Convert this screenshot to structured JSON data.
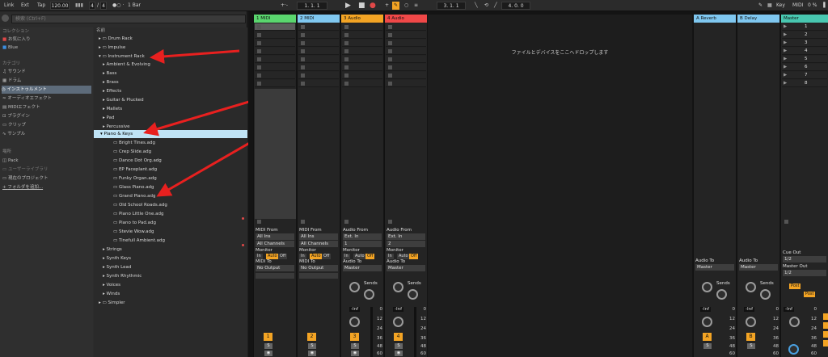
{
  "toolbar": {
    "link": "Link",
    "ext": "Ext",
    "tap": "Tap",
    "tempo": "120.00",
    "sig_num": "4",
    "sig_den": "4",
    "quant": "1 Bar",
    "pos1": "1. 1. 1",
    "pos2": "3. 1. 1",
    "pos3": "4. 0. 0",
    "key": "Key",
    "midi": "MIDI",
    "cpu": "0 %"
  },
  "browser": {
    "search_placeholder": "検索 (Ctrl+F)",
    "collections_header": "コレクション",
    "fav": "お気に入り",
    "blue": "Blue",
    "category_header": "カテゴリ",
    "categories": [
      "サウンド",
      "ドラム",
      "インストゥルメント",
      "オーディオエフェクト",
      "MIDIエフェクト",
      "プラグイン",
      "クリップ",
      "サンプル"
    ],
    "places_header": "場所",
    "places": [
      "Pack",
      "ユーザーライブラリ",
      "現在のプロジェクト",
      "フォルダを追加..."
    ],
    "files_header": "名前",
    "files": [
      "Drum Rack",
      "Impulse",
      "Instrument Rack",
      "Ambient & Evolving",
      "Bass",
      "Brass",
      "Effects",
      "Guitar & Plucked",
      "Mallets",
      "Pad",
      "Percussive",
      "Piano & Keys",
      "Bright Tines.adg",
      "Crep Slide.adg",
      "Dance Dot Org.adg",
      "EP Faceplant.adg",
      "Funky Organ.adg",
      "Glass Piano.adg",
      "Grand Piano.adg",
      "Old School Roads.adg",
      "Piano Little One.adg",
      "Piano to Pad.adg",
      "Stevie Wow.adg",
      "Tinefull Ambient.adg",
      "Strings",
      "Synth Keys",
      "Synth Lead",
      "Synth Rhythmic",
      "Voices",
      "Winds",
      "Simpler"
    ]
  },
  "tracks": [
    {
      "name": "1 MIDI",
      "color": "#5ad66e",
      "from": "MIDI From",
      "src": "All Ins",
      "ch": "All Channels",
      "to": "MIDI To",
      "dest": "No Output",
      "num": "1"
    },
    {
      "name": "2 MIDI",
      "color": "#80c8f0",
      "from": "MIDI From",
      "src": "All Ins",
      "ch": "All Channels",
      "to": "MIDI To",
      "dest": "No Output",
      "num": "2"
    },
    {
      "name": "3 Audio",
      "color": "#f3a424",
      "from": "Audio From",
      "src": "Ext. In",
      "ch": "1",
      "to": "Audio To",
      "dest": "Master",
      "num": "3"
    },
    {
      "name": "4 Audio",
      "color": "#f04848",
      "from": "Audio From",
      "src": "Ext. In",
      "ch": "2",
      "to": "Audio To",
      "dest": "Master",
      "num": "4"
    }
  ],
  "returns": [
    {
      "name": "A Reverb",
      "color": "#7fc7f0",
      "to": "Audio To",
      "dest": "Master",
      "num": "A"
    },
    {
      "name": "B Delay",
      "color": "#7fc7f0",
      "to": "Audio To",
      "dest": "Master",
      "num": "B"
    }
  ],
  "master": {
    "name": "Master",
    "color": "#48c7b0",
    "scenes": [
      "1",
      "2",
      "3",
      "4",
      "5",
      "6",
      "7",
      "8"
    ],
    "cue": "Cue Out",
    "cue_val": "1/2",
    "out": "Master Out",
    "out_val": "1/2",
    "post": "Post"
  },
  "mixer": {
    "monitor": "Monitor",
    "in": "In",
    "auto": "Auto",
    "off": "Off",
    "sends": "Sends",
    "inf": "-Inf",
    "scale": [
      "0",
      "12",
      "24",
      "36",
      "48",
      "60"
    ]
  },
  "drop_hint": "ファイルとデバイスをここへドロップします"
}
